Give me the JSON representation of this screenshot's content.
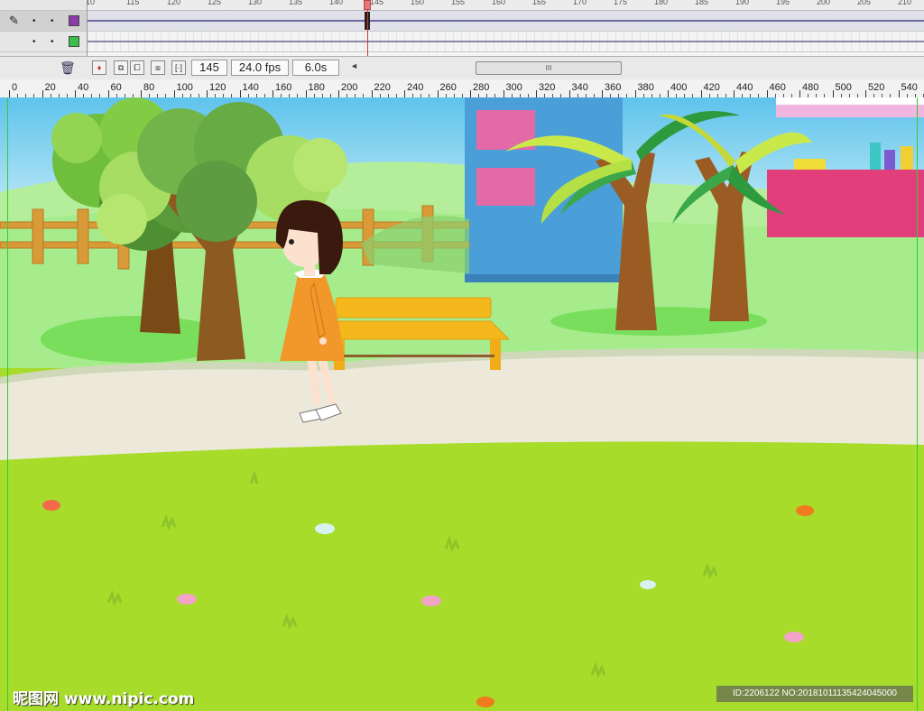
{
  "timeline": {
    "ruler_ticks": [
      "10",
      "115",
      "120",
      "125",
      "130",
      "135",
      "140",
      "145",
      "150",
      "155",
      "160",
      "165",
      "170",
      "175",
      "180",
      "185",
      "190",
      "195",
      "200",
      "205",
      "210"
    ],
    "layers": [
      {
        "color": "#8b3aa8",
        "selected": true
      },
      {
        "color": "#3bbf4a",
        "selected": false
      }
    ],
    "current_frame": "145",
    "frame_rate": "24.0 fps",
    "elapsed_time": "6.0s",
    "scroll_thumb_grip": "III"
  },
  "stage_ruler": {
    "labels": [
      "0",
      "20",
      "40",
      "60",
      "80",
      "100",
      "120",
      "140",
      "160",
      "180",
      "200",
      "220",
      "240",
      "260",
      "280",
      "300",
      "320",
      "340",
      "360",
      "380",
      "400",
      "420",
      "440",
      "460",
      "480",
      "500",
      "520",
      "540"
    ]
  },
  "scene": {
    "sky_color": "#7fd0ee",
    "grass_color": "#a7dc2a",
    "path_color": "#ece9db",
    "dress_color": "#f2972a",
    "bench_color": "#f4b81d",
    "building_color": "#4a9fd8",
    "wall_color": "#e33e7c"
  },
  "watermark": {
    "site_logo": "昵图网 www.nipic.com",
    "image_id": "ID:2206122 NO:20181011135424045000"
  }
}
